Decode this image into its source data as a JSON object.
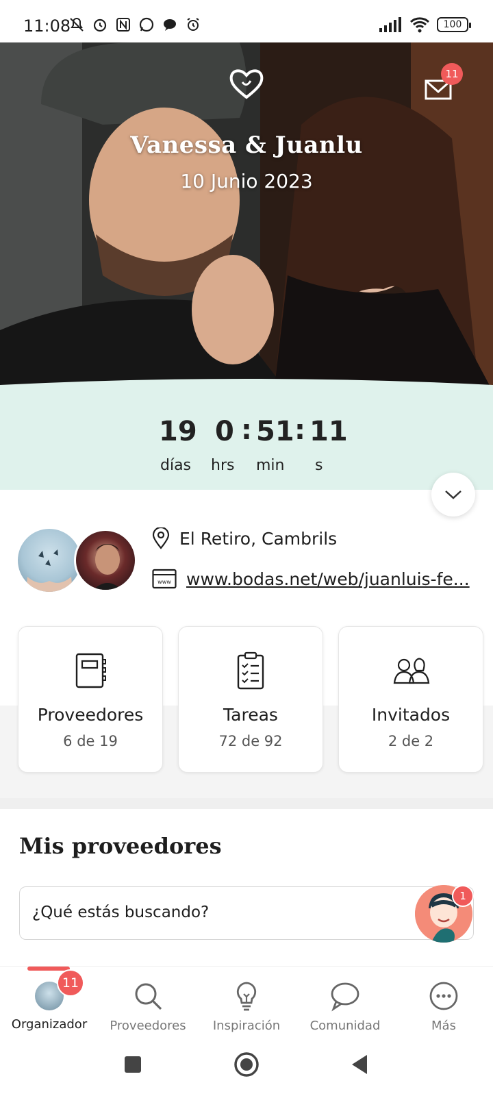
{
  "status_bar": {
    "time": "11:08",
    "battery": "100",
    "icons": [
      "muted-icon",
      "alarm-icon",
      "nfc-icon",
      "whatsapp-icon",
      "chat-icon",
      "alarm-clock-icon",
      "signal-icon",
      "wifi-icon",
      "battery-icon"
    ]
  },
  "hero": {
    "couple_name": "Vanessa & Juanlu",
    "date": "10 Junio 2023",
    "mail_badge": "11"
  },
  "countdown": {
    "days_value": "19",
    "days_label": "días",
    "hours_value": "0",
    "hours_label": "hrs",
    "minutes_value": "51",
    "minutes_label": "min",
    "seconds_value": "11",
    "seconds_label": "s",
    "separator": ":"
  },
  "info": {
    "location": "El Retiro, Cambrils",
    "website": "www.bodas.net/web/juanluis-fe..."
  },
  "cards": [
    {
      "title": "Proveedores",
      "subtitle": "6 de 19"
    },
    {
      "title": "Tareas",
      "subtitle": "72 de 92"
    },
    {
      "title": "Invitados",
      "subtitle": "2 de 2"
    }
  ],
  "vendors_section": {
    "title": "Mis proveedores",
    "search_placeholder": "¿Qué estás buscando?",
    "assistant_badge": "1"
  },
  "bottom_nav": {
    "items": [
      {
        "label": "Organizador",
        "badge": "11"
      },
      {
        "label": "Proveedores"
      },
      {
        "label": "Inspiración"
      },
      {
        "label": "Comunidad"
      },
      {
        "label": "Más"
      }
    ]
  },
  "colors": {
    "accent": "#f05a5a",
    "countdown_bg": "#dff2ec"
  }
}
